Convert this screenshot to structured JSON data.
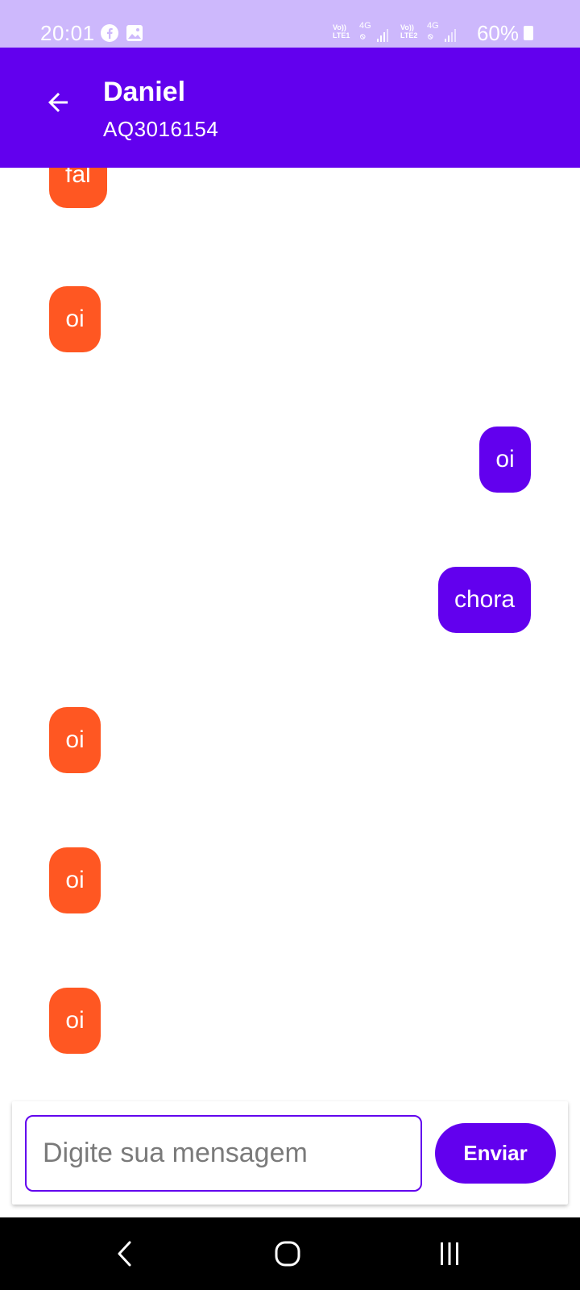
{
  "status_bar": {
    "time": "20:01",
    "battery": "60%",
    "sim1": {
      "top": "Vo))",
      "bottom": "LTE1",
      "net": "4G"
    },
    "sim2": {
      "top": "Vo))",
      "bottom": "LTE2",
      "net": "4G"
    },
    "icons": [
      "facebook-icon",
      "gallery-icon",
      "signal-icon",
      "battery-icon"
    ]
  },
  "header": {
    "name": "Daniel",
    "subtitle": "AQ3016154",
    "back_icon": "arrow-left-icon"
  },
  "messages": [
    {
      "text": "fal",
      "direction": "incoming"
    },
    {
      "text": "oi",
      "direction": "incoming"
    },
    {
      "text": "oi",
      "direction": "outgoing"
    },
    {
      "text": "chora",
      "direction": "outgoing"
    },
    {
      "text": "oi",
      "direction": "incoming"
    },
    {
      "text": "oi",
      "direction": "incoming"
    },
    {
      "text": "oi",
      "direction": "incoming"
    }
  ],
  "composer": {
    "input_value": "",
    "placeholder": "Digite sua mensagem",
    "send_label": "Enviar"
  },
  "nav": {
    "icons": [
      "back-chevron-icon",
      "home-icon",
      "recents-icon"
    ]
  },
  "colors": {
    "primary": "#6200ee",
    "status_bar": "#cdb8fc",
    "incoming_bubble": "#ff5722",
    "outgoing_bubble": "#6200ee"
  }
}
